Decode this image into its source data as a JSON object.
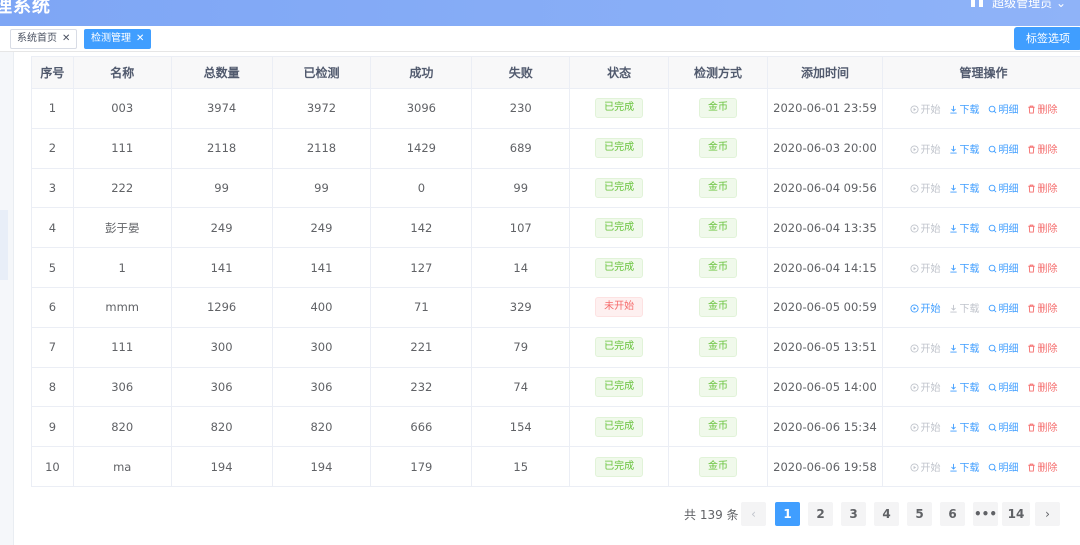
{
  "header": {
    "title": "理系统",
    "user": "超级管理员 ⌄"
  },
  "tags": {
    "items": [
      {
        "label": "系统首页",
        "close": "✕"
      },
      {
        "label": "检测管理",
        "close": "✕"
      }
    ],
    "options_label": "标签选项"
  },
  "table": {
    "columns": [
      "序号",
      "名称",
      "总数量",
      "已检测",
      "成功",
      "失败",
      "状态",
      "检测方式",
      "添加时间",
      "管理操作"
    ],
    "op_labels": {
      "start": "开始",
      "download": "下载",
      "detail": "明细",
      "delete": "删除"
    },
    "rows": [
      {
        "idx": "1",
        "name": "003",
        "total": "3974",
        "checked": "3972",
        "success": "3096",
        "fail": "230",
        "status": "已完成",
        "status_type": "done",
        "method": "金币",
        "time": "2020-06-01 23:59",
        "startable": false
      },
      {
        "idx": "2",
        "name": "111",
        "total": "2118",
        "checked": "2118",
        "success": "1429",
        "fail": "689",
        "status": "已完成",
        "status_type": "done",
        "method": "金币",
        "time": "2020-06-03 20:00",
        "startable": false
      },
      {
        "idx": "3",
        "name": "222",
        "total": "99",
        "checked": "99",
        "success": "0",
        "fail": "99",
        "status": "已完成",
        "status_type": "done",
        "method": "金币",
        "time": "2020-06-04 09:56",
        "startable": false
      },
      {
        "idx": "4",
        "name": "彭于晏",
        "total": "249",
        "checked": "249",
        "success": "142",
        "fail": "107",
        "status": "已完成",
        "status_type": "done",
        "method": "金币",
        "time": "2020-06-04 13:35",
        "startable": false
      },
      {
        "idx": "5",
        "name": "1",
        "total": "141",
        "checked": "141",
        "success": "127",
        "fail": "14",
        "status": "已完成",
        "status_type": "done",
        "method": "金币",
        "time": "2020-06-04 14:15",
        "startable": false
      },
      {
        "idx": "6",
        "name": "mmm",
        "total": "1296",
        "checked": "400",
        "success": "71",
        "fail": "329",
        "status": "未开始",
        "status_type": "notstart",
        "method": "金币",
        "time": "2020-06-05 00:59",
        "startable": true
      },
      {
        "idx": "7",
        "name": "111",
        "total": "300",
        "checked": "300",
        "success": "221",
        "fail": "79",
        "status": "已完成",
        "status_type": "done",
        "method": "金币",
        "time": "2020-06-05 13:51",
        "startable": false
      },
      {
        "idx": "8",
        "name": "306",
        "total": "306",
        "checked": "306",
        "success": "232",
        "fail": "74",
        "status": "已完成",
        "status_type": "done",
        "method": "金币",
        "time": "2020-06-05 14:00",
        "startable": false
      },
      {
        "idx": "9",
        "name": "820",
        "total": "820",
        "checked": "820",
        "success": "666",
        "fail": "154",
        "status": "已完成",
        "status_type": "done",
        "method": "金币",
        "time": "2020-06-06 15:34",
        "startable": false
      },
      {
        "idx": "10",
        "name": "ma",
        "total": "194",
        "checked": "194",
        "success": "179",
        "fail": "15",
        "status": "已完成",
        "status_type": "done",
        "method": "金币",
        "time": "2020-06-06 19:58",
        "startable": false
      }
    ]
  },
  "pagination": {
    "total_text": "共 139 条",
    "prev": "‹",
    "next": "›",
    "pages": [
      "1",
      "2",
      "3",
      "4",
      "5",
      "6",
      "•••",
      "14"
    ],
    "current": "1"
  },
  "colors": {
    "primary": "#409eff",
    "success": "#67c23a",
    "danger": "#f56c6c",
    "disabled": "#c0c4cc"
  }
}
